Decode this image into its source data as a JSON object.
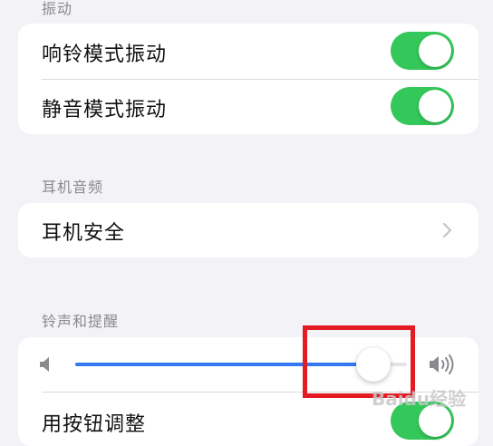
{
  "sections": {
    "vibration": {
      "header": "振动",
      "rows": [
        {
          "label": "响铃模式振动",
          "toggle_on": true
        },
        {
          "label": "静音模式振动",
          "toggle_on": true
        }
      ]
    },
    "headphone_audio": {
      "header": "耳机音频",
      "rows": [
        {
          "label": "耳机安全",
          "trailing": "chevron-right"
        }
      ]
    },
    "ringtones_alerts": {
      "header": "铃声和提醒",
      "volume_slider": {
        "value_fraction": 0.9,
        "min_icon": "speaker-low-icon",
        "max_icon": "speaker-high-icon"
      },
      "rows": [
        {
          "label": "用按钮调整",
          "toggle_on": true
        }
      ]
    }
  },
  "annotation": {
    "highlight_color": "#e31b23",
    "watermark_text": "Baidu经验"
  },
  "colors": {
    "background": "#f2f2f7",
    "toggle_on": "#34c759",
    "slider_fill": "#3478f6"
  }
}
